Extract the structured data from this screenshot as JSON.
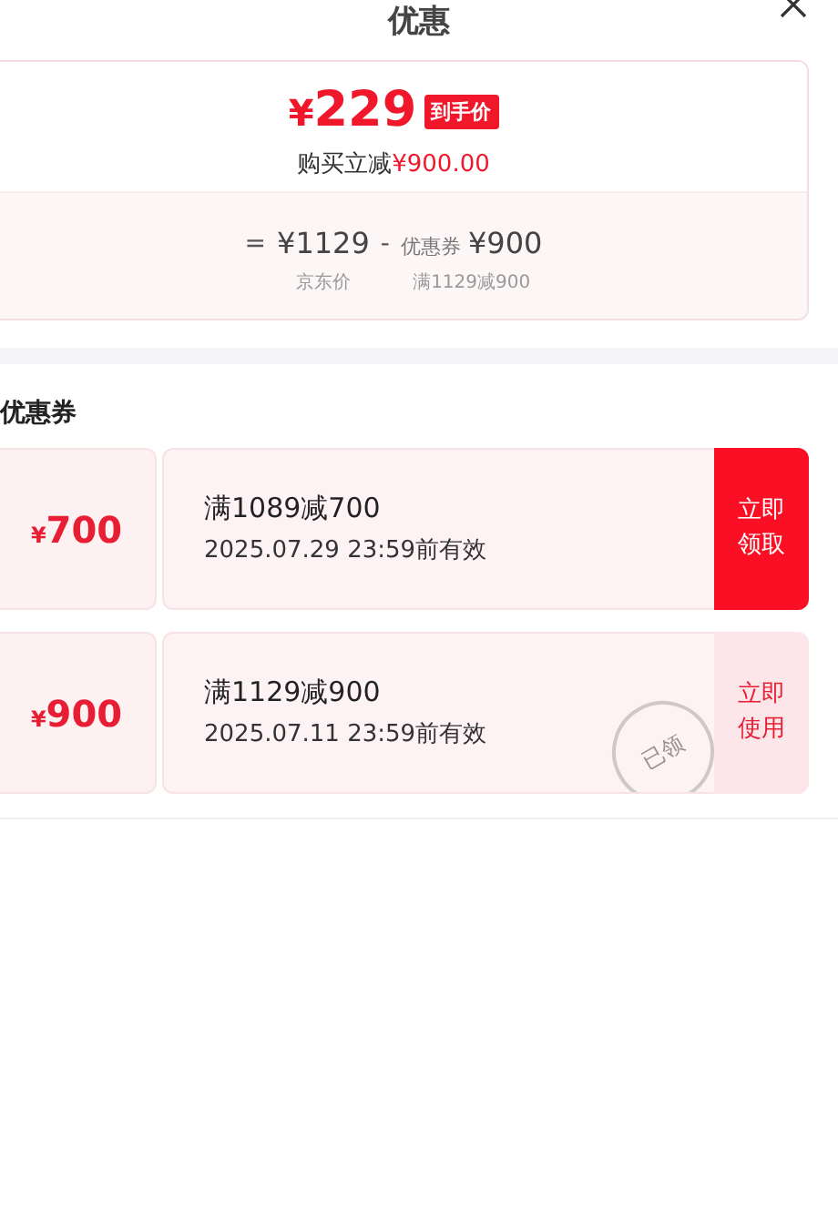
{
  "title": "优惠",
  "summary": {
    "currency": "¥",
    "price": "229",
    "price_tag": "到手价",
    "saving_label": "购买立减",
    "saving_amount": "¥900.00",
    "formula": [
      {
        "kind": "op",
        "text": "="
      },
      {
        "kind": "value",
        "text": "¥1129",
        "caption": "京东价"
      },
      {
        "kind": "op",
        "text": "-"
      },
      {
        "kind": "value",
        "prefix": "优惠券",
        "text": "¥900",
        "caption": "满1129减900"
      }
    ]
  },
  "coupons_heading": "优惠券",
  "coupons": [
    {
      "currency": "¥",
      "amount": "700",
      "condition": "满1089减700",
      "validity": "2025.07.29 23:59前有效",
      "action": "立即领取",
      "kind": "claim",
      "claimed": false
    },
    {
      "currency": "¥",
      "amount": "900",
      "condition": "满1129减900",
      "validity": "2025.07.11 23:59前有效",
      "action": "立即使用",
      "kind": "use",
      "claimed": true,
      "stamp": "已领"
    }
  ]
}
